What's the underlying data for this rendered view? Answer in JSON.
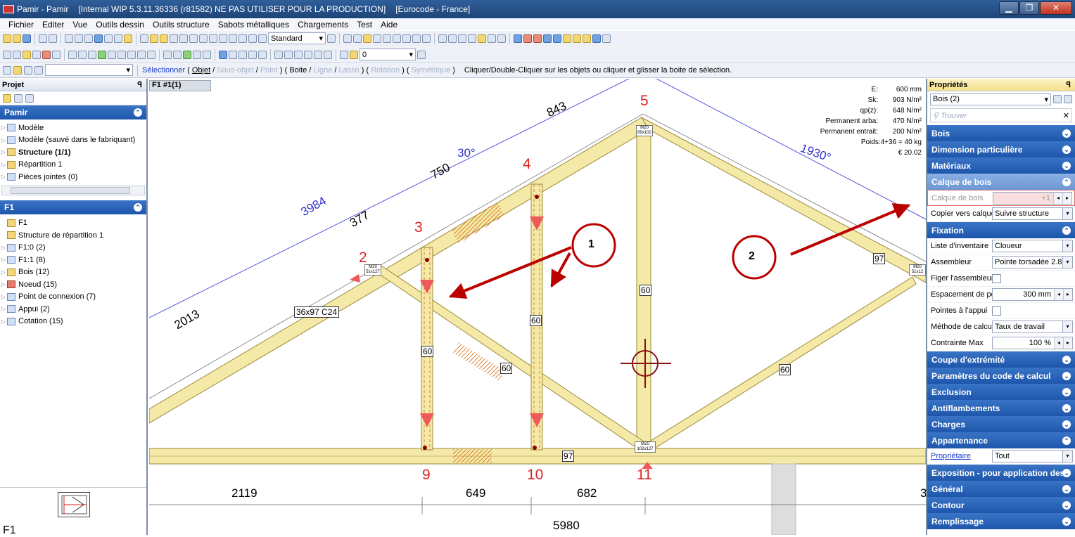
{
  "window": {
    "app": "Pamir - Pamir",
    "build": "[Internal WIP 5.3.11.36336 (r81582) NE PAS UTILISER POUR LA PRODUCTION]",
    "norm": "[Eurocode - France]",
    "min": "▁",
    "max": "❐",
    "close": "✕"
  },
  "menu": [
    "Fichier",
    "Editer",
    "Vue",
    "Outils dessin",
    "Outils structure",
    "Sabots métalliques",
    "Chargements",
    "Test",
    "Aide"
  ],
  "toolbar": {
    "style_combo": "Standard",
    "layer_combo": "0"
  },
  "select_bar": {
    "label": "Sélectionner",
    "objet": "Objet",
    "sous_objet": "Sous-objet",
    "point": "Point",
    "boite": "Boite",
    "ligne": "Ligne",
    "lasso": "Lasso",
    "rotation": "Rotation",
    "symetrique": "Symétrique",
    "help": "Cliquer/Double-Cliquer sur les objets ou cliquer et glisser la boite de sélection."
  },
  "project": {
    "title": "Projet",
    "pin": "ꟼ",
    "section": "Pamir",
    "items": [
      "Modèle",
      "Modèle (sauvé dans le fabriquant)",
      "Structure (1/1)",
      "Répartition 1",
      "Pièces jointes (0)"
    ],
    "section2": "F1",
    "items2": [
      "F1",
      "Structure de répartition 1",
      "F1:0 (2)",
      "F1:1 (8)",
      "Bois (12)",
      "Noeud (15)",
      "Point de connexion (7)",
      "Appui (2)",
      "Cotation (15)"
    ],
    "preview_label": "F1"
  },
  "canvas": {
    "tab": "F1 #1(1)",
    "info": {
      "E_l": "E:",
      "E": "600 mm",
      "Sk_l": "Sk:",
      "Sk": "903 N/m²",
      "qp_l": "qp(z):",
      "qp": "648 N/m²",
      "pa_l": "Permanent arba:",
      "pa": "470 N/m²",
      "pe_l": "Permanent entrait:",
      "pe": "200 N/m²",
      "poids": "Poids:4+36 = 40 kg",
      "price": "€ 20.02"
    },
    "dims": {
      "d843": "843",
      "d750": "750",
      "d377": "377",
      "d3984": "3984",
      "d2013": "2013",
      "a30": "30°",
      "a1930": "1930°",
      "d2119": "2119",
      "d649": "649",
      "d682": "682",
      "d5980": "5980",
      "d3": "3"
    },
    "nodes": {
      "n2": "2",
      "n3": "3",
      "n4": "4",
      "n5": "5",
      "n9": "9",
      "n10": "10",
      "n11": "11"
    },
    "labels": {
      "lum": "36x97 C24",
      "w60": "60",
      "w97": "97"
    },
    "plates": {
      "p_top": "M20",
      "p_top_s": "89x102",
      "p_left": "M20",
      "p_left_s": "51x127",
      "p_right": "M20",
      "p_right_s": "51x12",
      "p_bot": "M20",
      "p_bot_s": "102x127"
    },
    "callouts": {
      "c1": "1",
      "c2": "2"
    }
  },
  "props": {
    "title": "Propriétés",
    "selector": "Bois (2)",
    "search": "Trouver",
    "sections": [
      "Bois",
      "Dimension particulière",
      "Matériaux"
    ],
    "calque_section": "Calque de bois",
    "calque_label": "Calque de bois",
    "calque_value": "+1",
    "copier_label": "Copier vers calque",
    "copier_value": "Suivre structure",
    "fixation": "Fixation",
    "rows": [
      {
        "l": "Liste d'inventaire",
        "v": "Cloueur"
      },
      {
        "l": "Assembleur",
        "v": "Pointe torsadée 2.8"
      },
      {
        "l": "Figer l'assembleur",
        "v": ""
      },
      {
        "l": "Espacement de pc",
        "v": "300 mm"
      },
      {
        "l": "Pointes à l'appui",
        "v": ""
      },
      {
        "l": "Méthode de calcul",
        "v": "Taux de travail"
      },
      {
        "l": "Contrainte Max",
        "v": "100 %"
      }
    ],
    "sections2": [
      "Coupe d'extrémité",
      "Paramètres du code de calcul",
      "Exclusion",
      "Antiflambements",
      "Charges",
      "Appartenance"
    ],
    "owner_label": "Propriétaire",
    "owner_value": "Tout",
    "sections3": [
      "Exposition - pour application des",
      "Général",
      "Contour",
      "Remplissage"
    ]
  }
}
